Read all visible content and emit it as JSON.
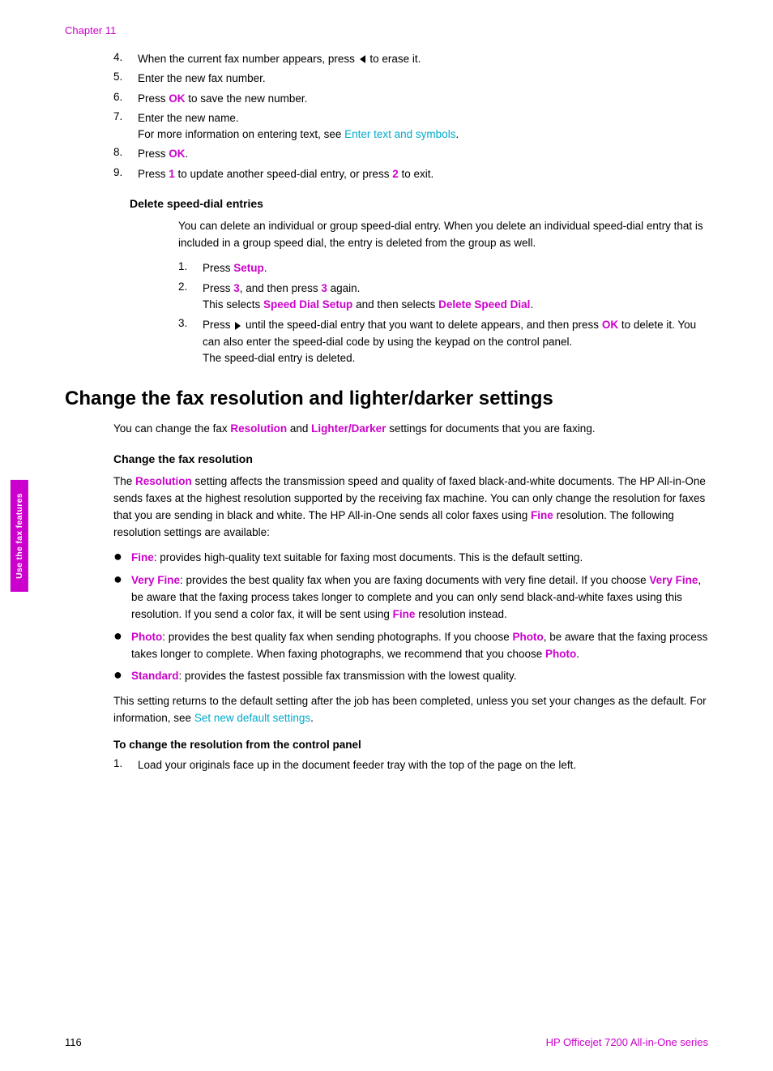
{
  "chapter_label": "Chapter 11",
  "footer": {
    "page": "116",
    "product": "HP Officejet 7200 All-in-One series"
  },
  "side_tab": "Use the fax features",
  "top_list": {
    "items": [
      {
        "num": "4.",
        "text": "When the current fax number appears, press",
        "arrow": "left",
        "text2": "to erase it."
      },
      {
        "num": "5.",
        "text": "Enter the new fax number."
      },
      {
        "num": "6.",
        "text": "Press",
        "ok": "OK",
        "text2": "to save the new number."
      },
      {
        "num": "7.",
        "text": "Enter the new name.",
        "subtext": "For more information on entering text, see",
        "link": "Enter text and symbols",
        "linkend": "."
      },
      {
        "num": "8.",
        "text": "Press",
        "ok": "OK",
        "text2": "."
      },
      {
        "num": "9.",
        "text": "Press",
        "bold": "1",
        "text2": "to update another speed-dial entry, or press",
        "bold2": "2",
        "text3": "to exit."
      }
    ]
  },
  "delete_section": {
    "heading": "Delete speed-dial entries",
    "body": "You can delete an individual or group speed-dial entry. When you delete an individual speed-dial entry that is included in a group speed dial, the entry is deleted from the group as well.",
    "steps": [
      {
        "num": "1.",
        "text": "Press",
        "setup": "Setup",
        "text2": "."
      },
      {
        "num": "2.",
        "text": "Press",
        "bold": "3",
        "text2": ", and then press",
        "bold2": "3",
        "text3": "again.",
        "subtext": "This selects",
        "speedlink1": "Speed Dial Setup",
        "subtext2": "and then selects",
        "speedlink2": "Delete Speed Dial",
        "subtext3": "."
      },
      {
        "num": "3.",
        "text": "Press",
        "arrow": "right",
        "text2": "until the speed-dial entry that you want to delete appears, and then press",
        "ok": "OK",
        "text3": "to delete it. You can also enter the speed-dial code by using the keypad on the control panel.",
        "subtext": "The speed-dial entry is deleted."
      }
    ]
  },
  "main_title": "Change the fax resolution and lighter/darker settings",
  "main_title_body": "You can change the fax",
  "main_title_resolution": "Resolution",
  "main_title_and": "and",
  "main_title_lighter": "Lighter/Darker",
  "main_title_end": "settings for documents that you are faxing.",
  "fax_resolution_section": {
    "heading": "Change the fax resolution",
    "body1": "The",
    "resolution_link": "Resolution",
    "body2": "setting affects the transmission speed and quality of faxed black-and-white documents. The HP All-in-One sends faxes at the highest resolution supported by the receiving fax machine. You can only change the resolution for faxes that you are sending in black and white. The HP All-in-One sends all color faxes using",
    "fine_link": "Fine",
    "body3": "resolution. The following resolution settings are available:",
    "bullets": [
      {
        "bold": "Fine",
        "text": ": provides high-quality text suitable for faxing most documents. This is the default setting."
      },
      {
        "bold": "Very Fine",
        "text": ": provides the best quality fax when you are faxing documents with very fine detail. If you choose",
        "bold2": "Very Fine",
        "text2": ", be aware that the faxing process takes longer to complete and you can only send black-and-white faxes using this resolution. If you send a color fax, it will be sent using",
        "fine2": "Fine",
        "text3": "resolution instead."
      },
      {
        "bold": "Photo",
        "text": ": provides the best quality fax when sending photographs. If you choose",
        "bold2": "Photo",
        "text2": ", be aware that the faxing process takes longer to complete. When faxing photographs, we recommend that you choose",
        "bold3": "Photo",
        "text3": "."
      },
      {
        "bold": "Standard",
        "text": ": provides the fastest possible fax transmission with the lowest quality."
      }
    ],
    "after_bullets": "This setting returns to the default setting after the job has been completed, unless you set your changes as the default. For information, see",
    "default_link": "Set new default settings",
    "after_link": ".",
    "sub_heading": "To change the resolution from the control panel",
    "control_steps": [
      {
        "num": "1.",
        "text": "Load your originals face up in the document feeder tray with the top of the page on the left."
      }
    ]
  }
}
